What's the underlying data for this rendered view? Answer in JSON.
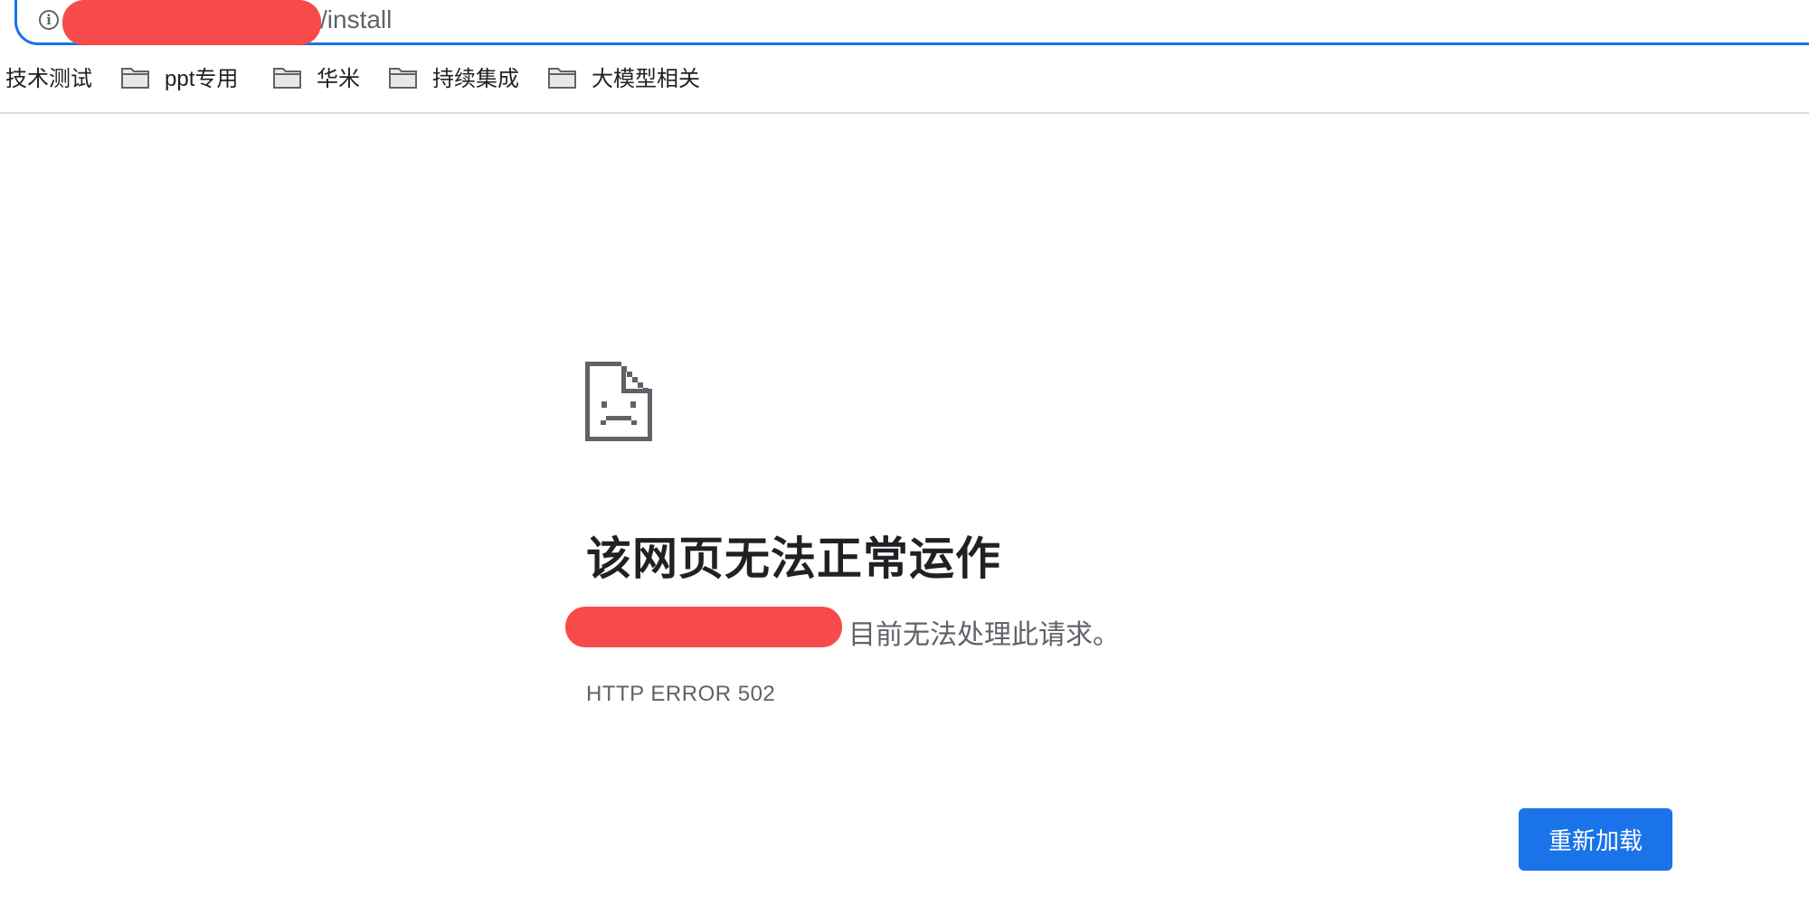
{
  "address_bar": {
    "url_suffix": "/install",
    "info_icon": "info-icon"
  },
  "bookmarks": [
    {
      "label": "技术测试",
      "icon": null
    },
    {
      "label": "ppt专用",
      "icon": "folder-icon"
    },
    {
      "label": "华米",
      "icon": "folder-icon"
    },
    {
      "label": "持续集成",
      "icon": "folder-icon"
    },
    {
      "label": "大模型相关",
      "icon": "folder-icon"
    }
  ],
  "error_page": {
    "icon": "sad-page-icon",
    "title": "该网页无法正常运作",
    "description_suffix": "目前无法处理此请求。",
    "error_code": "HTTP ERROR 502",
    "reload_label": "重新加载"
  },
  "colors": {
    "accent": "#1a73e8",
    "redaction": "#f74b4b",
    "secondary_text": "#5f6368"
  }
}
